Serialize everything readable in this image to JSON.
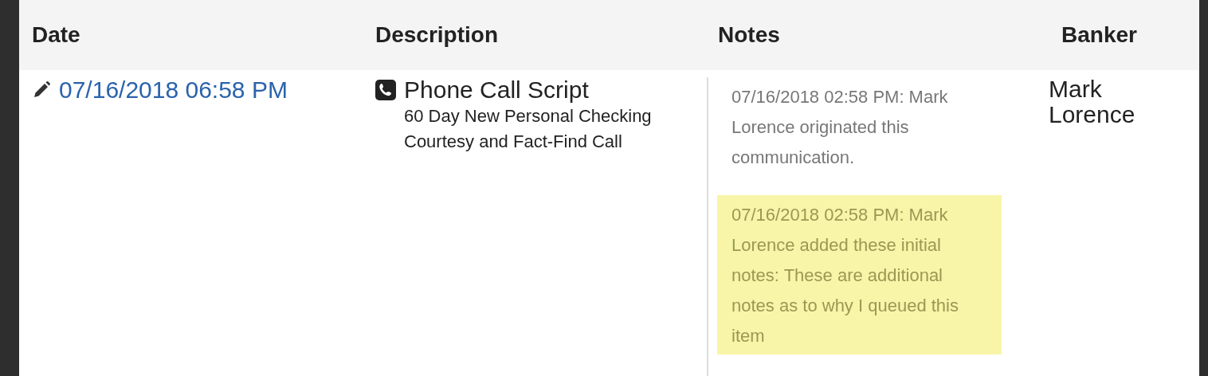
{
  "table": {
    "columns": [
      "Date",
      "Description",
      "Notes",
      "Banker"
    ],
    "rows": [
      {
        "date": "07/16/2018 06:58 PM",
        "type": "Phone Call Script",
        "description": "60 Day New Personal Checking Courtesy and Fact-Find Call",
        "notes": [
          {
            "text": "07/16/2018 02:58 PM: Mark Lorence originated this communication.",
            "highlighted": false
          },
          {
            "text": "07/16/2018 02:58 PM: Mark Lorence added these initial notes: These are additional notes as to why I queued this item",
            "highlighted": true
          }
        ],
        "banker": "Mark Lorence"
      }
    ]
  }
}
